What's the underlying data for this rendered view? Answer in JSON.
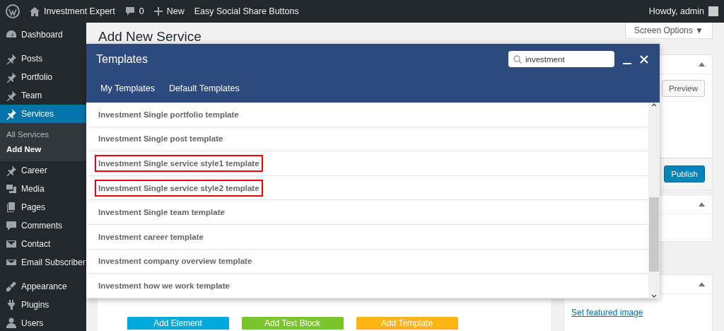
{
  "admin_bar": {
    "site": "Investment Expert",
    "comments": "0",
    "new": "New",
    "plugin": "Easy Social Share Buttons",
    "greeting": "Howdy, admin"
  },
  "sidebar": {
    "items": [
      {
        "label": "Dashboard",
        "selected": false,
        "gap_after": true
      },
      {
        "label": "Posts",
        "selected": false
      },
      {
        "label": "Portfolio",
        "selected": false
      },
      {
        "label": "Team",
        "selected": false
      },
      {
        "label": "Services",
        "selected": true,
        "children": [
          {
            "label": "All Services",
            "selected": false
          },
          {
            "label": "Add New",
            "selected": true
          }
        ]
      },
      {
        "label": "Career",
        "selected": false
      },
      {
        "label": "Media",
        "selected": false
      },
      {
        "label": "Pages",
        "selected": false
      },
      {
        "label": "Comments",
        "selected": false
      },
      {
        "label": "Contact",
        "selected": false
      },
      {
        "label": "Email Subscriber",
        "selected": false,
        "gap_after": true
      },
      {
        "label": "Appearance",
        "selected": false
      },
      {
        "label": "Plugins",
        "selected": false
      },
      {
        "label": "Users",
        "selected": false
      }
    ]
  },
  "page": {
    "title": "Add New Service",
    "screen_options": "Screen Options ▼"
  },
  "publish_box": {
    "preview": "Preview",
    "publish": "Publish"
  },
  "featured_box": {
    "link": "Set featured image"
  },
  "editor_buttons": [
    "Add Element",
    "Add Text Block",
    "Add Template"
  ],
  "modal": {
    "title": "Templates",
    "search": {
      "value": "investment"
    },
    "tabs": [
      {
        "label": "My Templates",
        "selected": false
      },
      {
        "label": "Default Templates",
        "selected": false
      }
    ],
    "templates": [
      {
        "name": "Investment Single portfolio template",
        "marked": false
      },
      {
        "name": "Investment Single post template",
        "marked": false
      },
      {
        "name": "Investment Single service style1 template",
        "marked": true
      },
      {
        "name": "Investment Single service style2 template",
        "marked": true
      },
      {
        "name": "Investment Single team template",
        "marked": false
      },
      {
        "name": "Investment career template",
        "marked": false
      },
      {
        "name": "Investment company overview template",
        "marked": false
      },
      {
        "name": "Investment how we work template",
        "marked": false
      }
    ]
  }
}
